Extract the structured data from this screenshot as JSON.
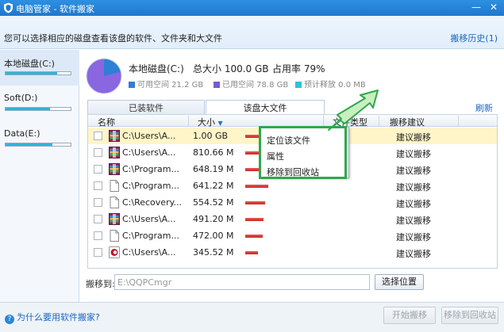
{
  "window": {
    "title": "电脑管家 - 软件搬家",
    "minimize": "—",
    "close": "✕"
  },
  "header": {
    "description": "您可以选择相应的磁盘查看该盘的软件、文件夹和大文件",
    "history_link": "搬移历史(1)"
  },
  "sidebar": {
    "disks": [
      {
        "label": "本地磁盘(C:)",
        "usage": 0.79,
        "active": true
      },
      {
        "label": "Soft(D:)",
        "usage": 0.68,
        "active": false
      },
      {
        "label": "Data(E:)",
        "usage": 0.72,
        "active": false
      }
    ]
  },
  "disk_info": {
    "name": "本地磁盘(C:)",
    "total": "总大小 100.0 GB",
    "used_rate": "占用率 79%",
    "available": "可用空间 21.2 GB",
    "used": "已用空间 78.8 GB",
    "estimated_free": "预计释放 0.0 MB",
    "colors": {
      "available": "#2e7fd6",
      "used": "#7a5ad8",
      "free": "#2ec4d8"
    }
  },
  "tabs": [
    {
      "label": "已装软件",
      "active": false
    },
    {
      "label": "该盘大文件",
      "active": true
    }
  ],
  "refresh_label": "刷新",
  "table": {
    "headers": {
      "name": "名称",
      "size": "大小",
      "type": "文件类型",
      "suggestion": "搬移建议",
      "sort_arrow": "▼"
    },
    "rows": [
      {
        "name": "C:\\Users\\A...",
        "size": "1.00 GB",
        "ratio": 1.0,
        "suggestion": "建议搬移",
        "icon": "rar-icon",
        "selected": true
      },
      {
        "name": "C:\\Users\\A...",
        "size": "810.66 MB",
        "ratio": 0.79,
        "suggestion": "建议搬移",
        "icon": "rar-icon",
        "selected": false
      },
      {
        "name": "C:\\Program...",
        "size": "648.19 MB",
        "ratio": 0.63,
        "suggestion": "建议搬移",
        "icon": "rar-icon",
        "selected": false
      },
      {
        "name": "C:\\Program...",
        "size": "641.22 MB",
        "ratio": 0.62,
        "suggestion": "建议搬移",
        "icon": "file-icon",
        "selected": false
      },
      {
        "name": "C:\\Recovery...",
        "size": "554.52 MB",
        "ratio": 0.54,
        "suggestion": "建议搬移",
        "icon": "file-icon",
        "selected": false
      },
      {
        "name": "C:\\Users\\A...",
        "size": "491.20 MB",
        "ratio": 0.48,
        "suggestion": "建议搬移",
        "icon": "rar-icon",
        "selected": false
      },
      {
        "name": "C:\\Program...",
        "size": "472.00 MB",
        "ratio": 0.46,
        "suggestion": "建议搬移",
        "icon": "file-icon",
        "selected": false
      },
      {
        "name": "C:\\Users\\A...",
        "size": "345.52 MB",
        "ratio": 0.34,
        "suggestion": "建议搬移",
        "icon": "media-icon",
        "selected": false
      }
    ]
  },
  "context_menu": {
    "items": [
      "定位该文件",
      "属性",
      "移除到回收站"
    ]
  },
  "move_to": {
    "label": "搬移到:",
    "path": "E:\\QQPCmgr",
    "choose_button": "选择位置"
  },
  "footer": {
    "help_icon": "?",
    "help_link": "为什么要用软件搬家?",
    "start_button": "开始搬移",
    "recycle_button": "移除到回收站"
  }
}
